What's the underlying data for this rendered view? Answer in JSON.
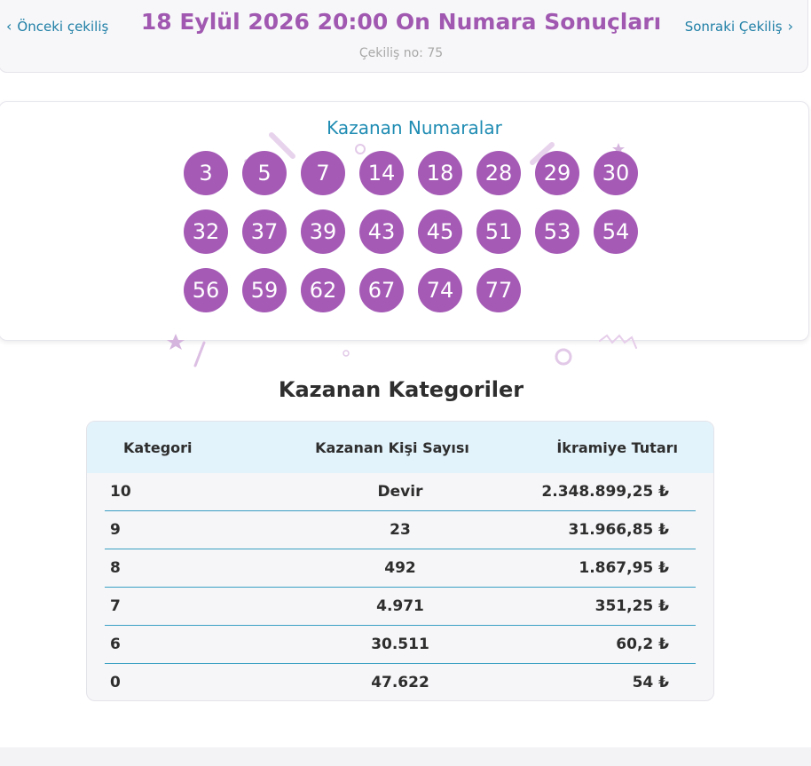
{
  "header": {
    "prev_label": "Önceki çekiliş",
    "next_label": "Sonraki Çekiliş",
    "title": "18 Eylül 2026 20:00 On Numara Sonuçları",
    "draw_no": "Çekiliş no: 75"
  },
  "winning_numbers": {
    "title": "Kazanan Numaralar",
    "numbers": [
      "3",
      "5",
      "7",
      "14",
      "18",
      "28",
      "29",
      "30",
      "32",
      "37",
      "39",
      "43",
      "45",
      "51",
      "53",
      "54",
      "56",
      "59",
      "62",
      "67",
      "74",
      "77"
    ]
  },
  "categories": {
    "title": "Kazanan Kategoriler",
    "columns": [
      "Kategori",
      "Kazanan Kişi Sayısı",
      "İkramiye Tutarı"
    ],
    "rows": [
      {
        "category": "10",
        "winners": "Devir",
        "prize": "2.348.899,25 ₺"
      },
      {
        "category": "9",
        "winners": "23",
        "prize": "31.966,85 ₺"
      },
      {
        "category": "8",
        "winners": "492",
        "prize": "1.867,95 ₺"
      },
      {
        "category": "7",
        "winners": "4.971",
        "prize": "351,25 ₺"
      },
      {
        "category": "6",
        "winners": "30.511",
        "prize": "60,2 ₺"
      },
      {
        "category": "0",
        "winners": "47.622",
        "prize": "54 ₺"
      }
    ]
  },
  "colors": {
    "ball": "#a55bb6",
    "title": "#a058b0",
    "link": "#1f7fa6",
    "table_header": "#e3f3fb"
  }
}
